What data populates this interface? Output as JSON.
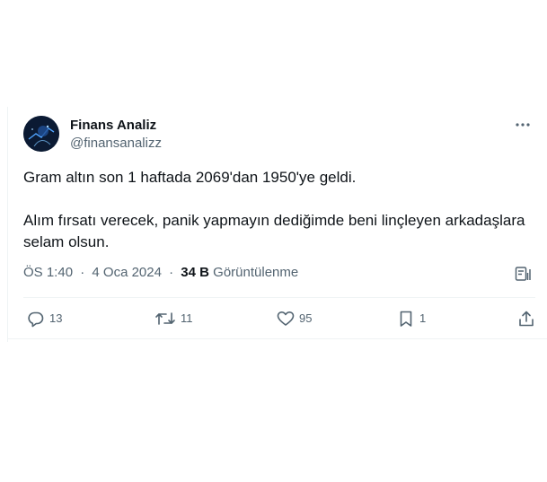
{
  "author": {
    "name": "Finans Analiz",
    "handle": "@finansanalizz",
    "avatar_icon": "avatar-image"
  },
  "tweet": {
    "text": "Gram altın son 1 haftada 2069'dan 1950'ye geldi.\n\nAlım fırsatı verecek, panik yapmayın dediğimde beni linçleyen arkadaşlara selam olsun.",
    "time": "ÖS 1:40",
    "date": "4 Oca 2024",
    "separator": "·",
    "views_count": "34 B",
    "views_label": "Görüntülenme"
  },
  "actions": {
    "replies": "13",
    "reposts": "11",
    "likes": "95",
    "bookmarks": "1"
  },
  "icons": {
    "more": "more-dots-icon",
    "analytics": "analytics-icon",
    "reply": "reply-icon",
    "repost": "repost-icon",
    "like": "heart-icon",
    "bookmark": "bookmark-icon",
    "share": "share-icon"
  },
  "colors": {
    "text_primary": "#0f1419",
    "text_secondary": "#536471",
    "divider": "#eff3f4"
  }
}
